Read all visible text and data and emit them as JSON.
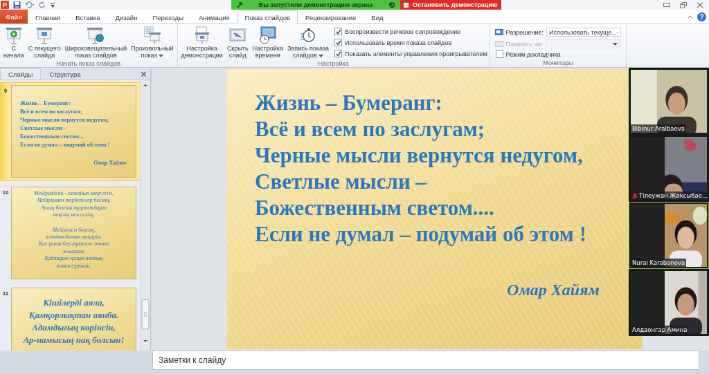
{
  "app_logo": "P",
  "share_bar": {
    "status": "Вы запустили демонстрацию экрана",
    "stop_button": "Остановить демонстрацию"
  },
  "help": "?",
  "tabs": [
    {
      "label": "Файл",
      "kind": "file",
      "selected": false
    },
    {
      "label": "Главная",
      "kind": "tab",
      "selected": false
    },
    {
      "label": "Вставка",
      "kind": "tab",
      "selected": false
    },
    {
      "label": "Дизайн",
      "kind": "tab",
      "selected": false
    },
    {
      "label": "Переходы",
      "kind": "tab",
      "selected": false
    },
    {
      "label": "Анимация",
      "kind": "tab",
      "selected": false
    },
    {
      "label": "Показ слайдов",
      "kind": "tab",
      "selected": true
    },
    {
      "label": "Рецензирование",
      "kind": "tab",
      "selected": false
    },
    {
      "label": "Вид",
      "kind": "tab",
      "selected": false
    }
  ],
  "ribbon": {
    "start_group": {
      "label": "Начать показ слайдов",
      "buttons": [
        {
          "lines": [
            "С",
            "начала"
          ],
          "dropdown": false
        },
        {
          "lines": [
            "С текущего",
            "слайда"
          ],
          "dropdown": false
        },
        {
          "lines": [
            "Широковещательный",
            "показ слайдов"
          ],
          "dropdown": false
        },
        {
          "lines": [
            "Произвольный",
            "показ"
          ],
          "dropdown": true
        }
      ]
    },
    "setup_group": {
      "label": "Настройка",
      "buttons": [
        {
          "lines": [
            "Настройка",
            "демонстрации"
          ],
          "dropdown": false
        },
        {
          "lines": [
            "Скрыть",
            "слайд"
          ],
          "dropdown": false
        },
        {
          "lines": [
            "Настройка",
            "времени"
          ],
          "dropdown": false
        },
        {
          "lines": [
            "Запись показа",
            "слайдов"
          ],
          "dropdown": true
        }
      ],
      "checkboxes": [
        {
          "label": "Воспроизвести речевое сопровождение",
          "checked": true
        },
        {
          "label": "Использовать время показа слайдов",
          "checked": true
        },
        {
          "label": "Показать элементы управления проигрывателем",
          "checked": true
        }
      ]
    },
    "monitors_group": {
      "label": "Мониторы",
      "resolution": {
        "label": "Разрешение:",
        "value": "Использовать текуще...",
        "disabled": false
      },
      "show_on": {
        "label": "Показать на:",
        "disabled": true
      },
      "presenter": {
        "label": "Режим докладчика",
        "checked": false
      }
    }
  },
  "pane_tabs": [
    {
      "label": "Слайды",
      "selected": true
    },
    {
      "label": "Структура",
      "selected": false
    }
  ],
  "thumbnails": [
    {
      "number": "9",
      "selected": true,
      "kind": "quote",
      "stanzas": [
        [
          "Жизнь  – Бумеранг:",
          "Всё и всем по заслугам;",
          "Черные мысли вернутся  недугом,",
          "Светлые мысли –",
          "Божественным светом....",
          "Если не думал – подумай об этом !"
        ]
      ],
      "author": "Омар Хайям"
    },
    {
      "number": "10",
      "selected": false,
      "kind": "verse",
      "stanzas": [
        [
          "Мейірімділік - ғажайып өмір есігі,",
          "Мейіріммен тербетілер бесігің,",
          "Ашық болсын мұқтаждарға",
          "көңілің мен есігің,"
        ],
        [
          "Мейірімсіз болсаң,",
          "алладан болмас кешірім.",
          "Қол ұшын бер мұқтаж жанға",
          "жылаған,",
          "Қайтарма қолын ананың",
          "көмек сұраған."
        ]
      ]
    },
    {
      "number": "11",
      "selected": false,
      "kind": "motto",
      "stanzas": [
        [
          "Кішілерді  аяла,",
          "Қамқорлықтан аянба.",
          "Адамдығың көрінсін,",
          "Ар-намысың нақ болсын!"
        ]
      ]
    }
  ],
  "slide": {
    "lines": [
      "Жизнь – Бумеранг:",
      "Всё и всем по заслугам;",
      "Черные мысли вернутся недугом,",
      "Светлые мысли –",
      "Божественным светом....",
      "Если не думал – подумай об этом !"
    ],
    "author": "Омар Хайям"
  },
  "participants": [
    {
      "name": "Bibinur Aralbaeva",
      "kind": "full",
      "muted": false,
      "speaking": false
    },
    {
      "name": "Тілеужан Жақсыбае...",
      "kind": "inset",
      "muted": true,
      "speaking": false
    },
    {
      "name": "Nurai Karabanova",
      "kind": "inset",
      "muted": false,
      "speaking": true
    },
    {
      "name": "Алдаонгар Амина",
      "kind": "inset",
      "muted": false,
      "speaking": false
    }
  ],
  "notes": {
    "placeholder": "Заметки к слайду"
  }
}
